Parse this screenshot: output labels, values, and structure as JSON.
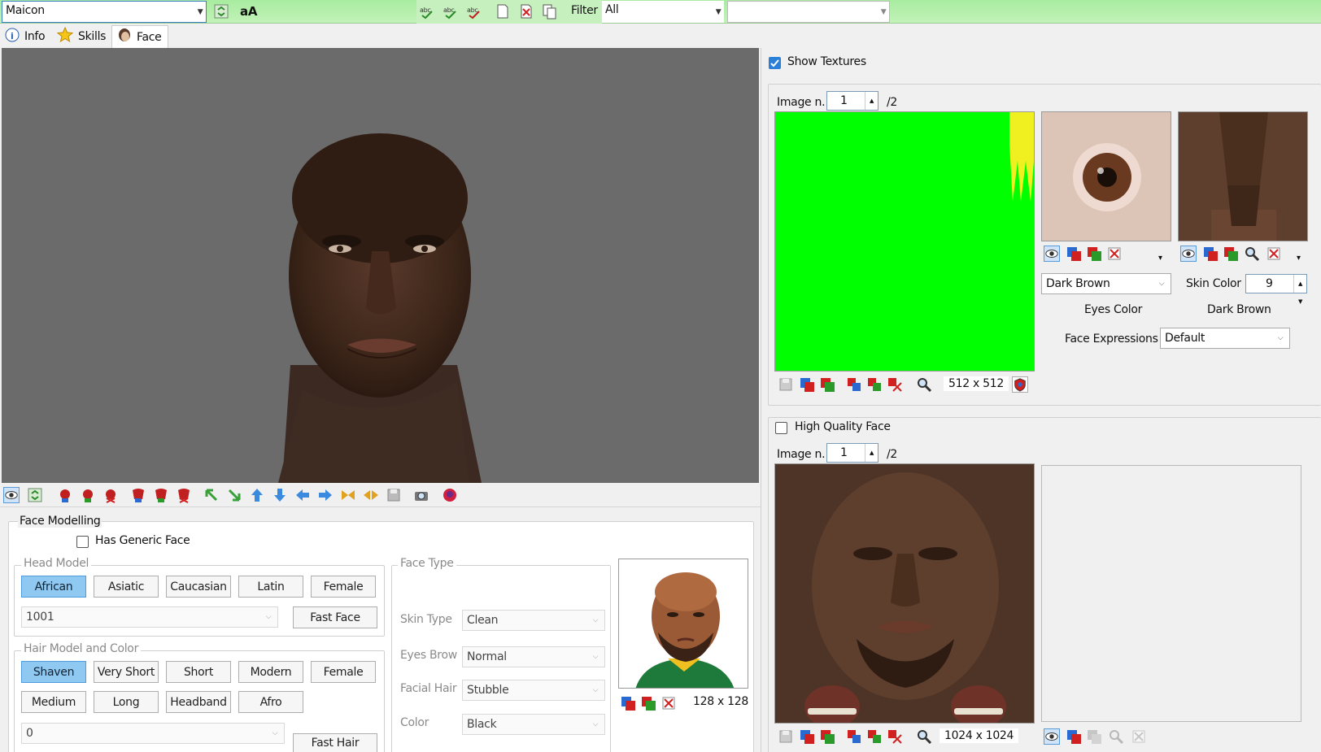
{
  "toolbar": {
    "player_name": "Maicon",
    "font_button": "aA",
    "filter_label": "Filter",
    "filter_value": "All",
    "second_combo": ""
  },
  "tabs": [
    {
      "label": "Info",
      "icon": "info-icon"
    },
    {
      "label": "Skills",
      "icon": "star-icon"
    },
    {
      "label": "Face",
      "icon": "face-icon"
    }
  ],
  "face_modelling": {
    "title": "Face Modelling",
    "has_generic_face": "Has Generic Face",
    "head_model": {
      "title": "Head Model",
      "buttons": [
        "African",
        "Asiatic",
        "Caucasian",
        "Latin",
        "Female"
      ],
      "selected": "African",
      "model_id": "1001",
      "fast_face": "Fast Face"
    },
    "hair_model": {
      "title": "Hair Model and Color",
      "buttons_row1": [
        "Shaven",
        "Very Short",
        "Short",
        "Modern",
        "Female"
      ],
      "buttons_row2": [
        "Medium",
        "Long",
        "Headband",
        "Afro"
      ],
      "selected": "Shaven",
      "hair_id": "0",
      "fast_hair": "Fast Hair"
    },
    "face_type": {
      "title": "Face Type",
      "skin_type_label": "Skin Type",
      "skin_type_value": "Clean",
      "eyes_brow_label": "Eyes Brow",
      "eyes_brow_value": "Normal",
      "facial_hair_label": "Facial Hair",
      "facial_hair_value": "Stubble",
      "color_label": "Color",
      "color_value": "Black"
    },
    "photo_size": "128 x 128"
  },
  "textures": {
    "show_textures": "Show Textures",
    "image_n_label": "Image n.",
    "image_n_value": "1",
    "image_total": "/2",
    "texture_size": "512 x 512",
    "eyes_color_value": "Dark Brown",
    "eyes_color_label": "Eyes Color",
    "skin_color_label": "Skin Color",
    "skin_color_value": "9",
    "skin_color_name": "Dark Brown",
    "face_expressions_label": "Face Expressions",
    "face_expressions_value": "Default"
  },
  "hq_face": {
    "label": "High Quality Face",
    "image_n_label": "Image n.",
    "image_n_value": "1",
    "image_total": "/2",
    "texture_size": "1024 x 1024"
  },
  "colors": {
    "toolbar_green": "#b4efaa",
    "viewport_gray": "#6b6b6b",
    "texture_green": "#00ff00",
    "selected_blue": "#8fc8f0"
  }
}
